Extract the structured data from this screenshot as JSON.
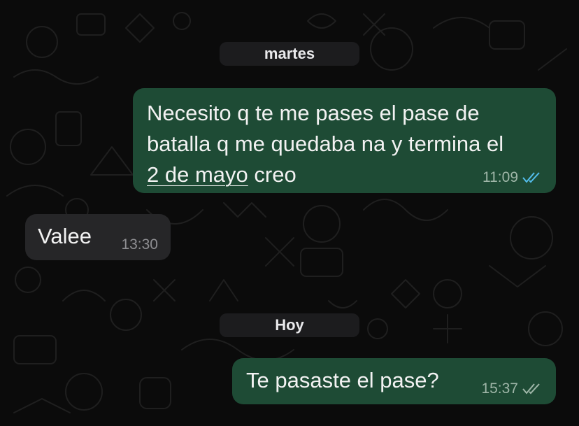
{
  "dividers": {
    "first": "martes",
    "second": "Hoy"
  },
  "messages": [
    {
      "direction": "outgoing",
      "text_before_link": "Necesito q te me pases el pase de\nbatalla q me quedaba na y termina el\n",
      "link_text": "2 de mayo",
      "text_after_link": " creo",
      "time": "11:09",
      "status": "read"
    },
    {
      "direction": "incoming",
      "text": "Valee",
      "time": "13:30"
    },
    {
      "direction": "outgoing",
      "text": "Te pasaste el pase?",
      "time": "15:37",
      "status": "delivered"
    }
  ],
  "colors": {
    "background": "#0b0b0b",
    "outgoing_bubble": "#1e4b35",
    "incoming_bubble": "#262628",
    "read_ticks": "#53bdeb",
    "delivered_ticks": "#9fb6a8"
  }
}
